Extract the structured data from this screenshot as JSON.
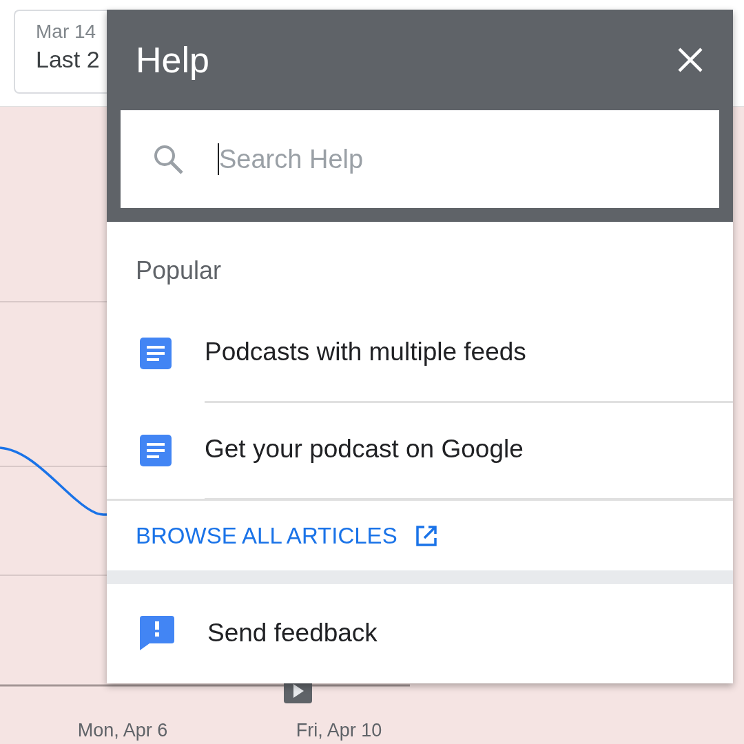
{
  "date_range": {
    "start": "Mar 14",
    "label": "Last 2"
  },
  "chart": {
    "x_labels": [
      "Mon, Apr 6",
      "Fri, Apr 10"
    ]
  },
  "help_panel": {
    "title": "Help",
    "search": {
      "placeholder": "Search Help"
    },
    "section_title": "Popular",
    "articles": [
      {
        "title": "Podcasts with multiple feeds"
      },
      {
        "title": "Get your podcast on Google"
      }
    ],
    "browse_link": "BROWSE ALL ARTICLES",
    "feedback": "Send feedback"
  }
}
